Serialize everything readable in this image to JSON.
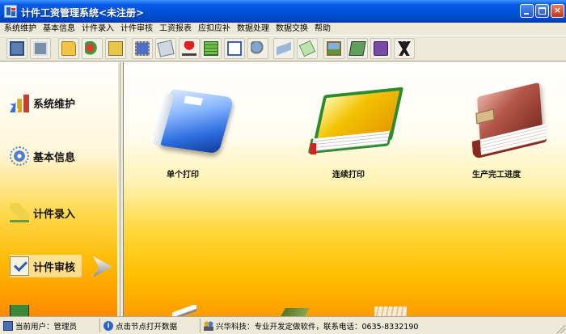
{
  "window": {
    "title": "计件工资管理系统<未注册>",
    "controls": {
      "minimize": "_",
      "maximize": "□",
      "close": "×"
    }
  },
  "menu": [
    "系统维护",
    "基本信息",
    "计件录入",
    "计件审核",
    "工资报表",
    "应扣应补",
    "数据处理",
    "数据交换",
    "帮助"
  ],
  "toolbar": {
    "buttons": [
      "monitor-icon",
      "screen-icon",
      "folder-icon",
      "refresh-icon",
      "folder-open-icon",
      "copy-icon",
      "edit-icon",
      "umbrella-icon",
      "ledger-icon",
      "report-icon",
      "search-icon",
      "filter-icon",
      "tag-icon",
      "picture-icon",
      "pencil-icon",
      "help-book-icon",
      "runner-icon"
    ]
  },
  "sidebar": {
    "items": [
      {
        "label": "系统维护",
        "icon": "bar-chart-icon"
      },
      {
        "label": "基本信息",
        "icon": "gear-icon"
      },
      {
        "label": "计件录入",
        "icon": "pencil-icon"
      },
      {
        "label": "计件审核",
        "icon": "check-icon"
      }
    ],
    "active_index": 3
  },
  "workarea": {
    "tiles": [
      {
        "label": "单个打印",
        "icon": "blue-book-icon"
      },
      {
        "label": "连续打印",
        "icon": "green-book-icon"
      },
      {
        "label": "生产完工进度",
        "icon": "red-book-icon"
      }
    ]
  },
  "statusbar": {
    "user": "当前用户：管理员",
    "hint": "点击节点打开数据",
    "company": "兴华科技：专业开发定做软件，联系电话：0635-8332190"
  }
}
